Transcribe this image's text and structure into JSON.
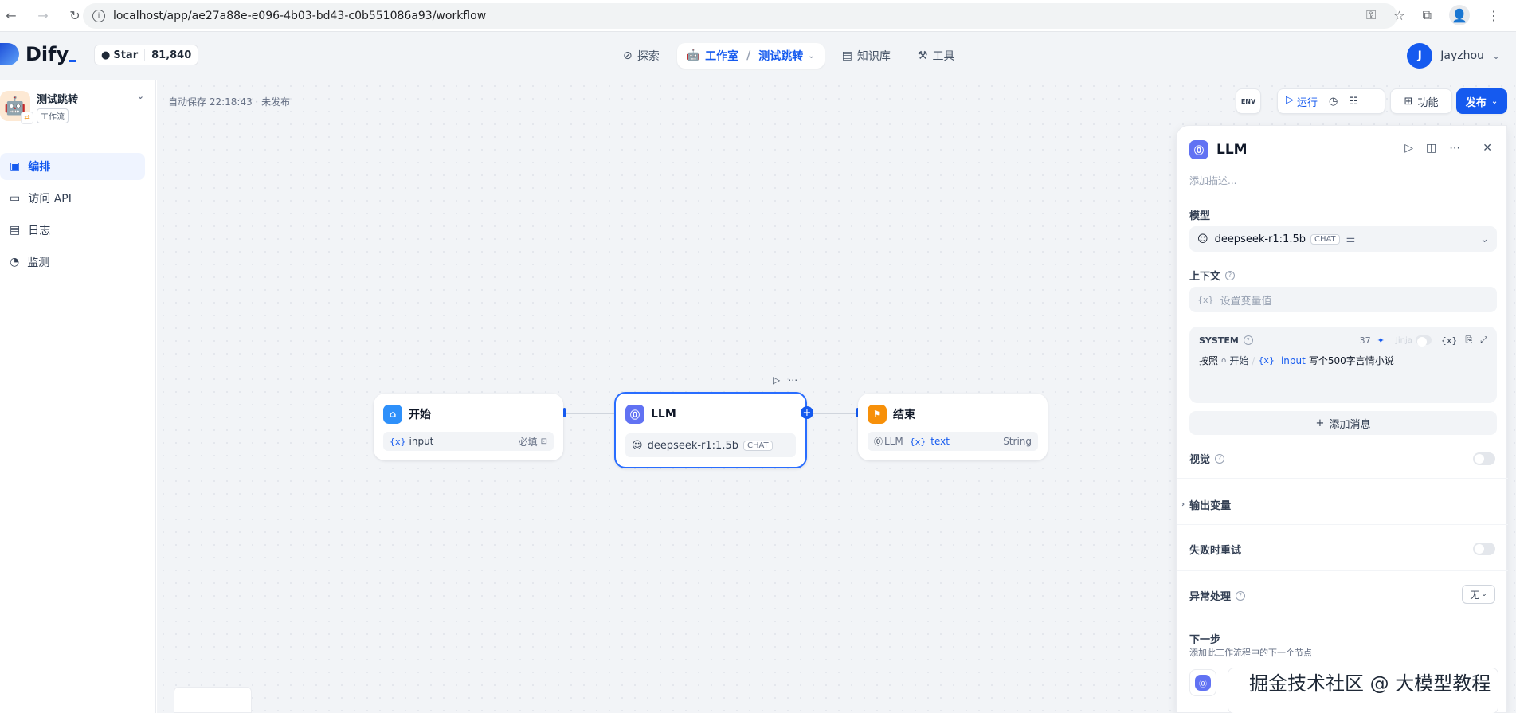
{
  "browser": {
    "url": "localhost/app/ae27a88e-e096-4b03-bd43-c0b551086a93/workflow"
  },
  "header": {
    "logo": "Dify",
    "star_label": "Star",
    "star_count": "81,840",
    "nav": [
      {
        "label": "探索"
      },
      {
        "label": "工作室"
      },
      {
        "label": "测试跳转"
      },
      {
        "label": "知识库"
      },
      {
        "label": "工具"
      }
    ],
    "user_initial": "J",
    "user_name": "Jayzhou"
  },
  "sidebar": {
    "app_name": "测试跳转",
    "app_type": "工作流",
    "items": [
      {
        "label": "编排"
      },
      {
        "label": "访问 API"
      },
      {
        "label": "日志"
      },
      {
        "label": "监测"
      }
    ]
  },
  "canvas": {
    "autosave": "自动保存 22:18:43 · 未发布",
    "toolbar": {
      "env": "ENV",
      "run": "运行",
      "features": "功能",
      "publish": "发布"
    }
  },
  "nodes": {
    "start": {
      "title": "开始",
      "var": "input",
      "required": "必填"
    },
    "llm": {
      "title": "LLM",
      "model": "deepseek-r1:1.5b",
      "tag": "CHAT"
    },
    "end": {
      "title": "结束",
      "source": "LLM",
      "var": "text",
      "type": "String"
    }
  },
  "panel": {
    "title": "LLM",
    "desc_placeholder": "添加描述...",
    "model_label": "模型",
    "model": "deepseek-r1:1.5b",
    "model_tag": "CHAT",
    "context_label": "上下文",
    "context_placeholder": "设置变量值",
    "system_label": "SYSTEM",
    "token_count": "37",
    "jinja": "Jinja",
    "prompt_prefix": "按照",
    "prompt_node": "开始",
    "prompt_var": "input",
    "prompt_suffix": "写个500字言情小说",
    "add_message": "添加消息",
    "vision_label": "视觉",
    "output_label": "输出变量",
    "retry_label": "失败时重试",
    "error_label": "异常处理",
    "error_value": "无",
    "next_label": "下一步",
    "next_hint": "添加此工作流程中的下一个节点"
  },
  "watermark": "掘金技术社区 @ 大模型教程",
  "colors": {
    "primary": "#155aef",
    "start_icon": "#2e90fa",
    "llm_icon": "#6172f3",
    "end_icon": "#f79009"
  }
}
